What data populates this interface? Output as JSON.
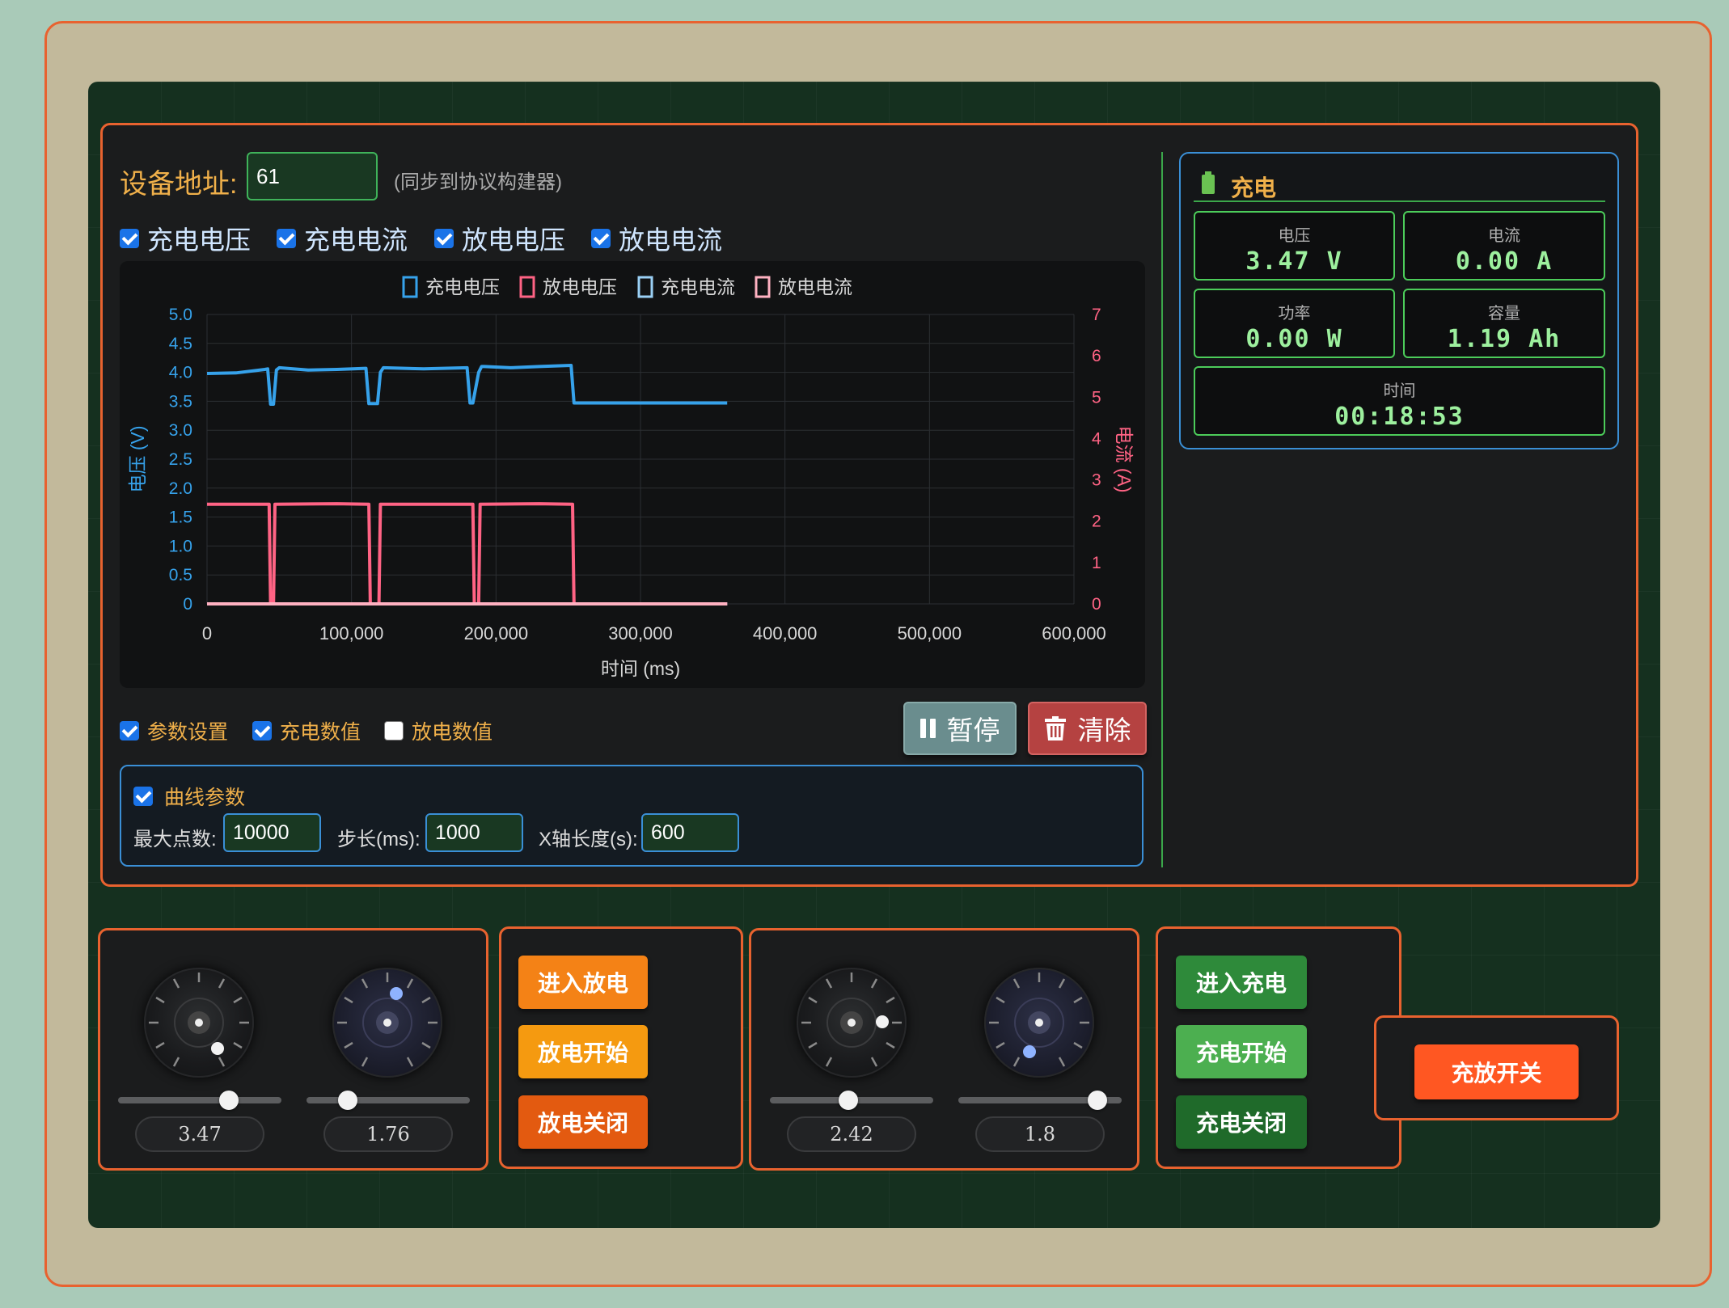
{
  "device": {
    "address_label": "设备地址:",
    "address_value": "61",
    "sync_note": "(同步到协议构建器)"
  },
  "series_toggles": [
    {
      "label": "充电电压",
      "checked": true
    },
    {
      "label": "充电电流",
      "checked": true
    },
    {
      "label": "放电电压",
      "checked": true
    },
    {
      "label": "放电电流",
      "checked": true
    }
  ],
  "chart_data": {
    "type": "line",
    "legend": [
      "充电电压",
      "放电电压",
      "充电电流",
      "放电电流"
    ],
    "legend_placement": "top",
    "xlabel": "时间 (ms)",
    "ylabel_left": "电压 (V)",
    "ylabel_right": "电流 (A)",
    "xlim": [
      0,
      600000
    ],
    "ylim_left": [
      0,
      5.0
    ],
    "ylim_right": [
      0,
      7
    ],
    "x_ticks": [
      "0",
      "100,000",
      "200,000",
      "300,000",
      "400,000",
      "500,000",
      "600,000"
    ],
    "y_left_ticks": [
      "0",
      "0.5",
      "1.0",
      "1.5",
      "2.0",
      "2.5",
      "3.0",
      "3.5",
      "4.0",
      "4.5",
      "5.0"
    ],
    "y_right_ticks": [
      "0",
      "1",
      "2",
      "3",
      "4",
      "5",
      "6",
      "7"
    ],
    "grid": true,
    "series": [
      {
        "name": "充电电压",
        "axis": "left",
        "color": "#36a2eb",
        "x": [
          0,
          20000,
          40000,
          42000,
          44000,
          46000,
          48000,
          50000,
          70000,
          90000,
          110000,
          112000,
          114000,
          118000,
          120000,
          122000,
          150000,
          180000,
          182000,
          184000,
          188000,
          190000,
          192000,
          210000,
          230000,
          252000,
          254000,
          300000,
          360000
        ],
        "y": [
          3.98,
          3.99,
          4.05,
          4.06,
          3.45,
          3.45,
          4.04,
          4.08,
          4.04,
          4.05,
          4.07,
          3.46,
          3.46,
          3.46,
          4.0,
          4.08,
          4.06,
          4.08,
          3.47,
          3.47,
          4.0,
          4.1,
          4.1,
          4.08,
          4.1,
          4.12,
          3.47,
          3.47,
          3.47
        ]
      },
      {
        "name": "放电电压",
        "axis": "left",
        "color": "#ff6384",
        "x": [
          0,
          43000,
          44000,
          46000,
          47000,
          90000,
          112000,
          113000,
          119000,
          120000,
          180000,
          184000,
          185000,
          188000,
          189000,
          230000,
          253000,
          254000,
          300000,
          360000
        ],
        "y": [
          1.72,
          1.72,
          0,
          0,
          1.72,
          1.73,
          1.72,
          0,
          0,
          1.72,
          1.72,
          1.72,
          0,
          0,
          1.72,
          1.73,
          1.72,
          0,
          0,
          0
        ]
      },
      {
        "name": "充电电流",
        "axis": "right",
        "color": "#9ad0f5",
        "x": [
          0,
          360000
        ],
        "y": [
          0,
          0
        ]
      },
      {
        "name": "放电电流",
        "axis": "right",
        "color": "#ffb1c1",
        "x": [
          0,
          360000
        ],
        "y": [
          0,
          0
        ]
      }
    ]
  },
  "panel_toggles": [
    {
      "label": "参数设置",
      "checked": true
    },
    {
      "label": "充电数值",
      "checked": true
    },
    {
      "label": "放电数值",
      "checked": false
    }
  ],
  "actions": {
    "pause_label": "暂停",
    "clear_label": "清除"
  },
  "curve_params": {
    "title": "曲线参数",
    "checked": true,
    "max_points_label": "最大点数:",
    "max_points_value": "10000",
    "step_label": "步长(ms):",
    "step_value": "1000",
    "xlen_label": "X轴长度(s):",
    "xlen_value": "600"
  },
  "charge_status": {
    "title": "充电",
    "voltage_label": "电压",
    "voltage_value": "3.47 V",
    "current_label": "电流",
    "current_value": "0.00 A",
    "power_label": "功率",
    "power_value": "0.00 W",
    "capacity_label": "容量",
    "capacity_value": "1.19 Ah",
    "time_label": "时间",
    "time_value": "00:18:53"
  },
  "knob_group_1": {
    "value_a": "3.47",
    "value_b": "1.76",
    "slider_a": 0.68,
    "slider_b": 0.25
  },
  "knob_group_2": {
    "value_a": "2.42",
    "value_b": "1.8",
    "slider_a": 0.48,
    "slider_b": 0.85
  },
  "discharge_buttons": {
    "enter": "进入放电",
    "start": "放电开始",
    "stop": "放电关闭"
  },
  "charge_buttons": {
    "enter": "进入充电",
    "start": "充电开始",
    "stop": "充电关闭"
  },
  "master_switch": "充放开关",
  "colors": {
    "accent_orange": "#e8622f",
    "charge_voltage": "#36a2eb",
    "discharge_voltage": "#ff6384",
    "status_green": "#9df09e"
  }
}
